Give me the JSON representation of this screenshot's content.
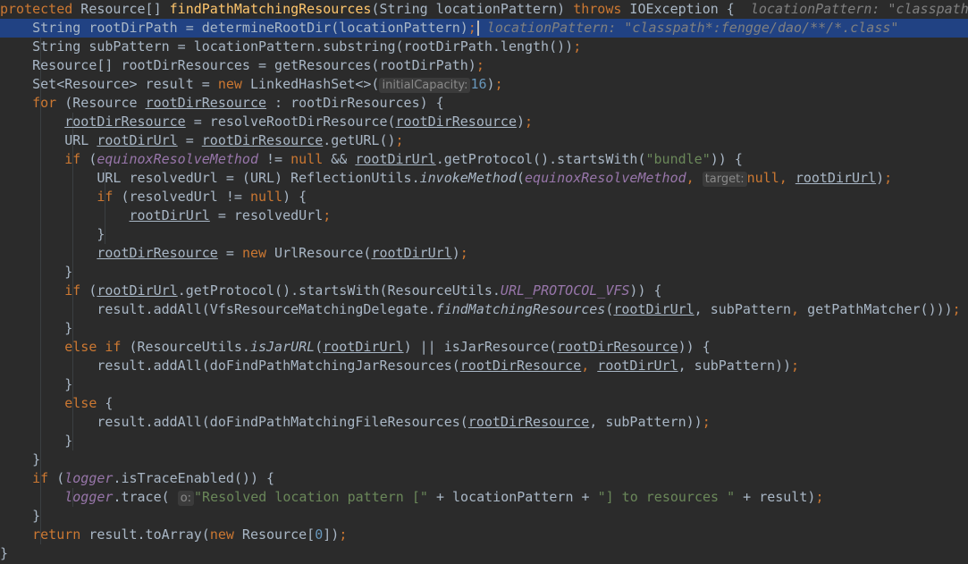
{
  "editor": {
    "theme_colors": {
      "background": "#2b2b2b",
      "current_line": "#214283",
      "keyword": "#cc7832",
      "method_declaration": "#ffc66d",
      "string": "#6a8759",
      "number": "#6897bb",
      "field": "#9876aa",
      "plain": "#a9b7c6"
    },
    "inline_hints": {
      "initial_capacity": "initialCapacity:",
      "target": "target:",
      "o": "o:"
    },
    "debug_values": {
      "line1": "locationPattern: \"classpath",
      "line2": "locationPattern: \"classpath*:fengge/dao/**/*.class\""
    },
    "lines": {
      "l1_a": "protected",
      "l1_b": " Resource[] ",
      "l1_c": "findPathMatchingResources",
      "l1_d": "(String locationPattern) ",
      "l1_e": "throws",
      "l1_f": " IOException {",
      "l2_a": "    String rootDirPath = determineRootDir(locationPattern)",
      "l2_b": ";",
      "l3_a": "    String subPattern = locationPattern.substring(rootDirPath.length())",
      "l3_b": ";",
      "l4_a": "    Resource[] rootDirResources = getResources(rootDirPath)",
      "l4_b": ";",
      "l5_a": "    Set<Resource> result = ",
      "l5_b": "new",
      "l5_c": " LinkedHashSet<>(",
      "l5_d": "16",
      "l5_e": ")",
      "l5_f": ";",
      "l6_a": "    ",
      "l6_b": "for",
      "l6_c": " (Resource ",
      "l6_d": "rootDirResource",
      "l6_e": " : rootDirResources) {",
      "l7_a": "        ",
      "l7_b": "rootDirResource",
      "l7_c": " = resolveRootDirResource(",
      "l7_d": "rootDirResource",
      "l7_e": ")",
      "l7_f": ";",
      "l8_a": "        URL ",
      "l8_b": "rootDirUrl",
      "l8_c": " = ",
      "l8_d": "rootDirResource",
      "l8_e": ".getURL()",
      "l8_f": ";",
      "l9_a": "        ",
      "l9_b": "if",
      "l9_c": " (",
      "l9_d": "equinoxResolveMethod",
      "l9_e": " != ",
      "l9_f": "null",
      "l9_g": " && ",
      "l9_h": "rootDirUrl",
      "l9_i": ".getProtocol().startsWith(",
      "l9_j": "\"bundle\"",
      "l9_k": ")) {",
      "l10_a": "            URL resolvedUrl = (URL) ReflectionUtils.",
      "l10_b": "invokeMethod",
      "l10_c": "(",
      "l10_d": "equinoxResolveMethod",
      "l10_e": ", ",
      "l10_f": "null",
      "l10_g": ", ",
      "l10_h": "rootDirUrl",
      "l10_i": ")",
      "l10_j": ";",
      "l11_a": "            ",
      "l11_b": "if",
      "l11_c": " (resolvedUrl != ",
      "l11_d": "null",
      "l11_e": ") {",
      "l12_a": "                ",
      "l12_b": "rootDirUrl",
      "l12_c": " = resolvedUrl",
      "l12_d": ";",
      "l13": "            }",
      "l14_a": "            ",
      "l14_b": "rootDirResource",
      "l14_c": " = ",
      "l14_d": "new",
      "l14_e": " UrlResource(",
      "l14_f": "rootDirUrl",
      "l14_g": ")",
      "l14_h": ";",
      "l15": "        }",
      "l16_a": "        ",
      "l16_b": "if",
      "l16_c": " (",
      "l16_d": "rootDirUrl",
      "l16_e": ".getProtocol().startsWith(ResourceUtils.",
      "l16_f": "URL_PROTOCOL_VFS",
      "l16_g": ")) {",
      "l17_a": "            result.addAll(VfsResourceMatchingDelegate.",
      "l17_b": "findMatchingResources",
      "l17_c": "(",
      "l17_d": "rootDirUrl",
      "l17_e": ", subPattern",
      "l17_f": ", ",
      "l17_g": "getPathMatcher()))",
      "l17_h": ";",
      "l18": "        }",
      "l19_a": "        ",
      "l19_b": "else if",
      "l19_c": " (ResourceUtils.",
      "l19_d": "isJarURL",
      "l19_e": "(",
      "l19_f": "rootDirUrl",
      "l19_g": ") || isJarResource(",
      "l19_h": "rootDirResource",
      "l19_i": ")) {",
      "l20_a": "            result.addAll(doFindPathMatchingJarResources(",
      "l20_b": "rootDirResource",
      "l20_c": ", ",
      "l20_d": "rootDirUrl",
      "l20_e": ", subPattern))",
      "l20_f": ";",
      "l21": "        }",
      "l22_a": "        ",
      "l22_b": "else",
      "l22_c": " {",
      "l23_a": "            result.addAll(doFindPathMatchingFileResources(",
      "l23_b": "rootDirResource",
      "l23_c": ", subPattern))",
      "l23_d": ";",
      "l24": "        }",
      "l25": "    }",
      "l26_a": "    ",
      "l26_b": "if",
      "l26_c": " (",
      "l26_d": "logger",
      "l26_e": ".isTraceEnabled()) {",
      "l27_a": "        ",
      "l27_b": "logger",
      "l27_c": ".trace( ",
      "l27_d": "\"Resolved location pattern [\"",
      "l27_e": " + locationPattern + ",
      "l27_f": "\"] to resources \"",
      "l27_g": " + result)",
      "l27_h": ";",
      "l28": "    }",
      "l29_a": "    ",
      "l29_b": "return",
      "l29_c": " result.toArray(",
      "l29_d": "new",
      "l29_e": " Resource[",
      "l29_f": "0",
      "l29_g": "])",
      "l29_h": ";",
      "l30": "}"
    }
  }
}
